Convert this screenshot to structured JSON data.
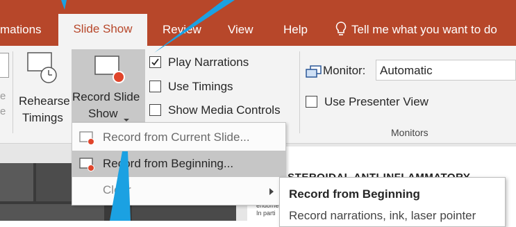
{
  "tabs": {
    "animations": "mations",
    "slide_show": "Slide Show",
    "review": "Review",
    "view": "View",
    "help": "Help",
    "tell_me": "Tell me what you want to do"
  },
  "ribbon": {
    "rehearse_line1": "Rehearse",
    "rehearse_line2": "Timings",
    "record_line1": "Record Slide",
    "record_line2": "Show",
    "play_narrations": "Play Narrations",
    "use_timings": "Use Timings",
    "show_media_controls": "Show Media Controls",
    "monitor_label": "Monitor:",
    "monitor_value": "Automatic",
    "use_presenter_view": "Use Presenter View",
    "monitors_group": "Monitors"
  },
  "menu": {
    "items": [
      {
        "label": "Record from Current Slide..."
      },
      {
        "label": "Record from Beginning..."
      },
      {
        "label": "Clear"
      }
    ]
  },
  "tooltip": {
    "title": "Record from Beginning",
    "text": "Record narrations, ink, laser pointer"
  },
  "slide": {
    "heading": "I-STEROIDAL ANTI-INFLAMMATORY",
    "small1": "endome",
    "small2": "In parti"
  },
  "colors": {
    "accent": "#b7472a",
    "callout": "#1ba1e2",
    "record_dot": "#e0452b"
  },
  "state": {
    "play_narrations_checked": true,
    "use_timings_checked": false,
    "show_media_controls_checked": false,
    "use_presenter_view_checked": false
  }
}
